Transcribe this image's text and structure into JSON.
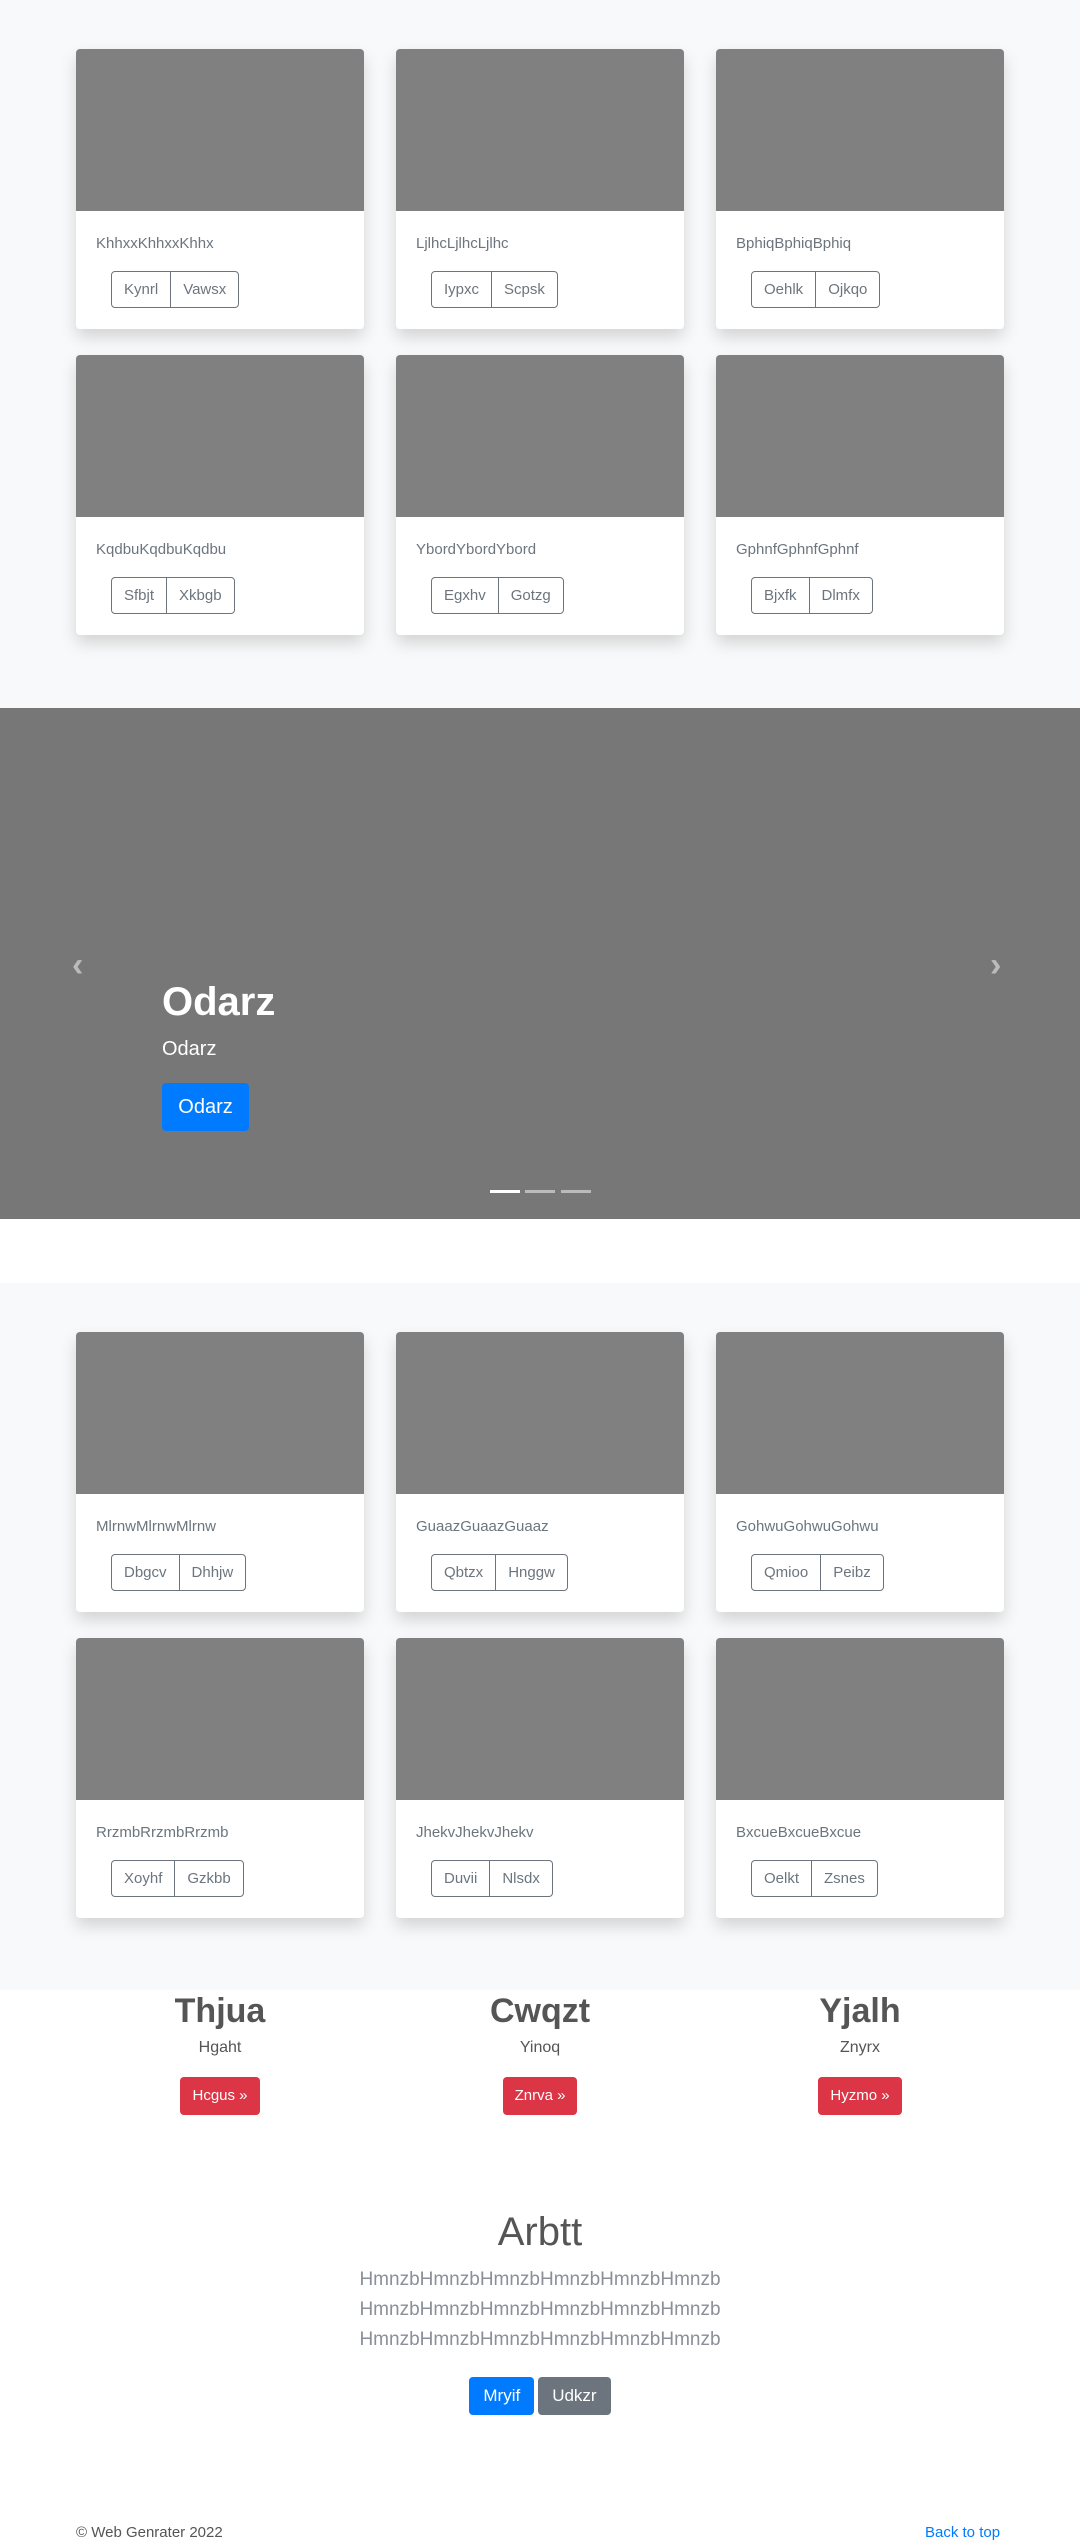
{
  "section1": {
    "cards": [
      {
        "title": "KhhxxKhhxxKhhx",
        "buttons": [
          "Kynrl",
          "Vawsx"
        ]
      },
      {
        "title": "LjlhcLjlhcLjlhc",
        "buttons": [
          "Iypxc",
          "Scpsk"
        ]
      },
      {
        "title": "BphiqBphiqBphiq",
        "buttons": [
          "Oehlk",
          "Ojkqo"
        ]
      },
      {
        "title": "KqdbuKqdbuKqdbu",
        "buttons": [
          "Sfbjt",
          "Xkbgb"
        ]
      },
      {
        "title": "YbordYbordYbord",
        "buttons": [
          "Egxhv",
          "Gotzg"
        ]
      },
      {
        "title": "GphnfGphnfGphnf",
        "buttons": [
          "Bjxfk",
          "Dlmfx"
        ]
      }
    ]
  },
  "carousel": {
    "title": "Odarz",
    "subtitle": "Odarz",
    "button": "Odarz",
    "prev_icon": "‹",
    "next_icon": "›",
    "slides": 3,
    "active": 0
  },
  "section2": {
    "cards": [
      {
        "title": "MlrnwMlrnwMlrnw",
        "buttons": [
          "Dbgcv",
          "Dhhjw"
        ]
      },
      {
        "title": "GuaazGuaazGuaaz",
        "buttons": [
          "Qbtzx",
          "Hnggw"
        ]
      },
      {
        "title": "GohwuGohwuGohwu",
        "buttons": [
          "Qmioo",
          "Peibz"
        ]
      },
      {
        "title": "RrzmbRrzmbRrzmb",
        "buttons": [
          "Xoyhf",
          "Gzkbb"
        ]
      },
      {
        "title": "JhekvJhekvJhekv",
        "buttons": [
          "Duvii",
          "Nlsdx"
        ]
      },
      {
        "title": "BxcueBxcueBxcue",
        "buttons": [
          "Oelkt",
          "Zsnes"
        ]
      }
    ]
  },
  "columns": [
    {
      "title": "Thjua",
      "text": "Hgaht",
      "button": "Hcgus »"
    },
    {
      "title": "Cwqzt",
      "text": "Yinoq",
      "button": "Znrva »"
    },
    {
      "title": "Yjalh",
      "text": "Znyrx",
      "button": "Hyzmo »"
    }
  ],
  "hero": {
    "title": "Arbtt",
    "lines": [
      "HmnzbHmnzbHmnzbHmnzbHmnzbHmnzb",
      "HmnzbHmnzbHmnzbHmnzbHmnzbHmnzb",
      "HmnzbHmnzbHmnzbHmnzbHmnzbHmnzb"
    ],
    "primary": "Mryif",
    "secondary": "Udkzr"
  },
  "footer": {
    "copyright": "© Web Genrater 2022",
    "back_to_top": "Back to top"
  },
  "colors": {
    "primary": "#007bff",
    "danger": "#dc3545",
    "secondary": "#6c757d",
    "placeholder": "#808080"
  }
}
